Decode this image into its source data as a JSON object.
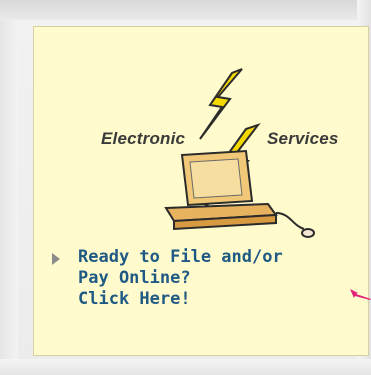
{
  "logo": {
    "left_word": "Electronic",
    "right_word": "Services",
    "icon": "computer-lightning-icon"
  },
  "cta": {
    "line1": "Ready to File and/or",
    "line2": "Pay Online?",
    "line3": "Click Here!"
  },
  "colors": {
    "card_bg": "#fffbcc",
    "link": "#1f5a85",
    "accent_pink": "#e0207a",
    "bolt": "#f5d800"
  },
  "icons": [
    "triangle-bullet-icon",
    "pink-pointer-arrow-icon"
  ]
}
